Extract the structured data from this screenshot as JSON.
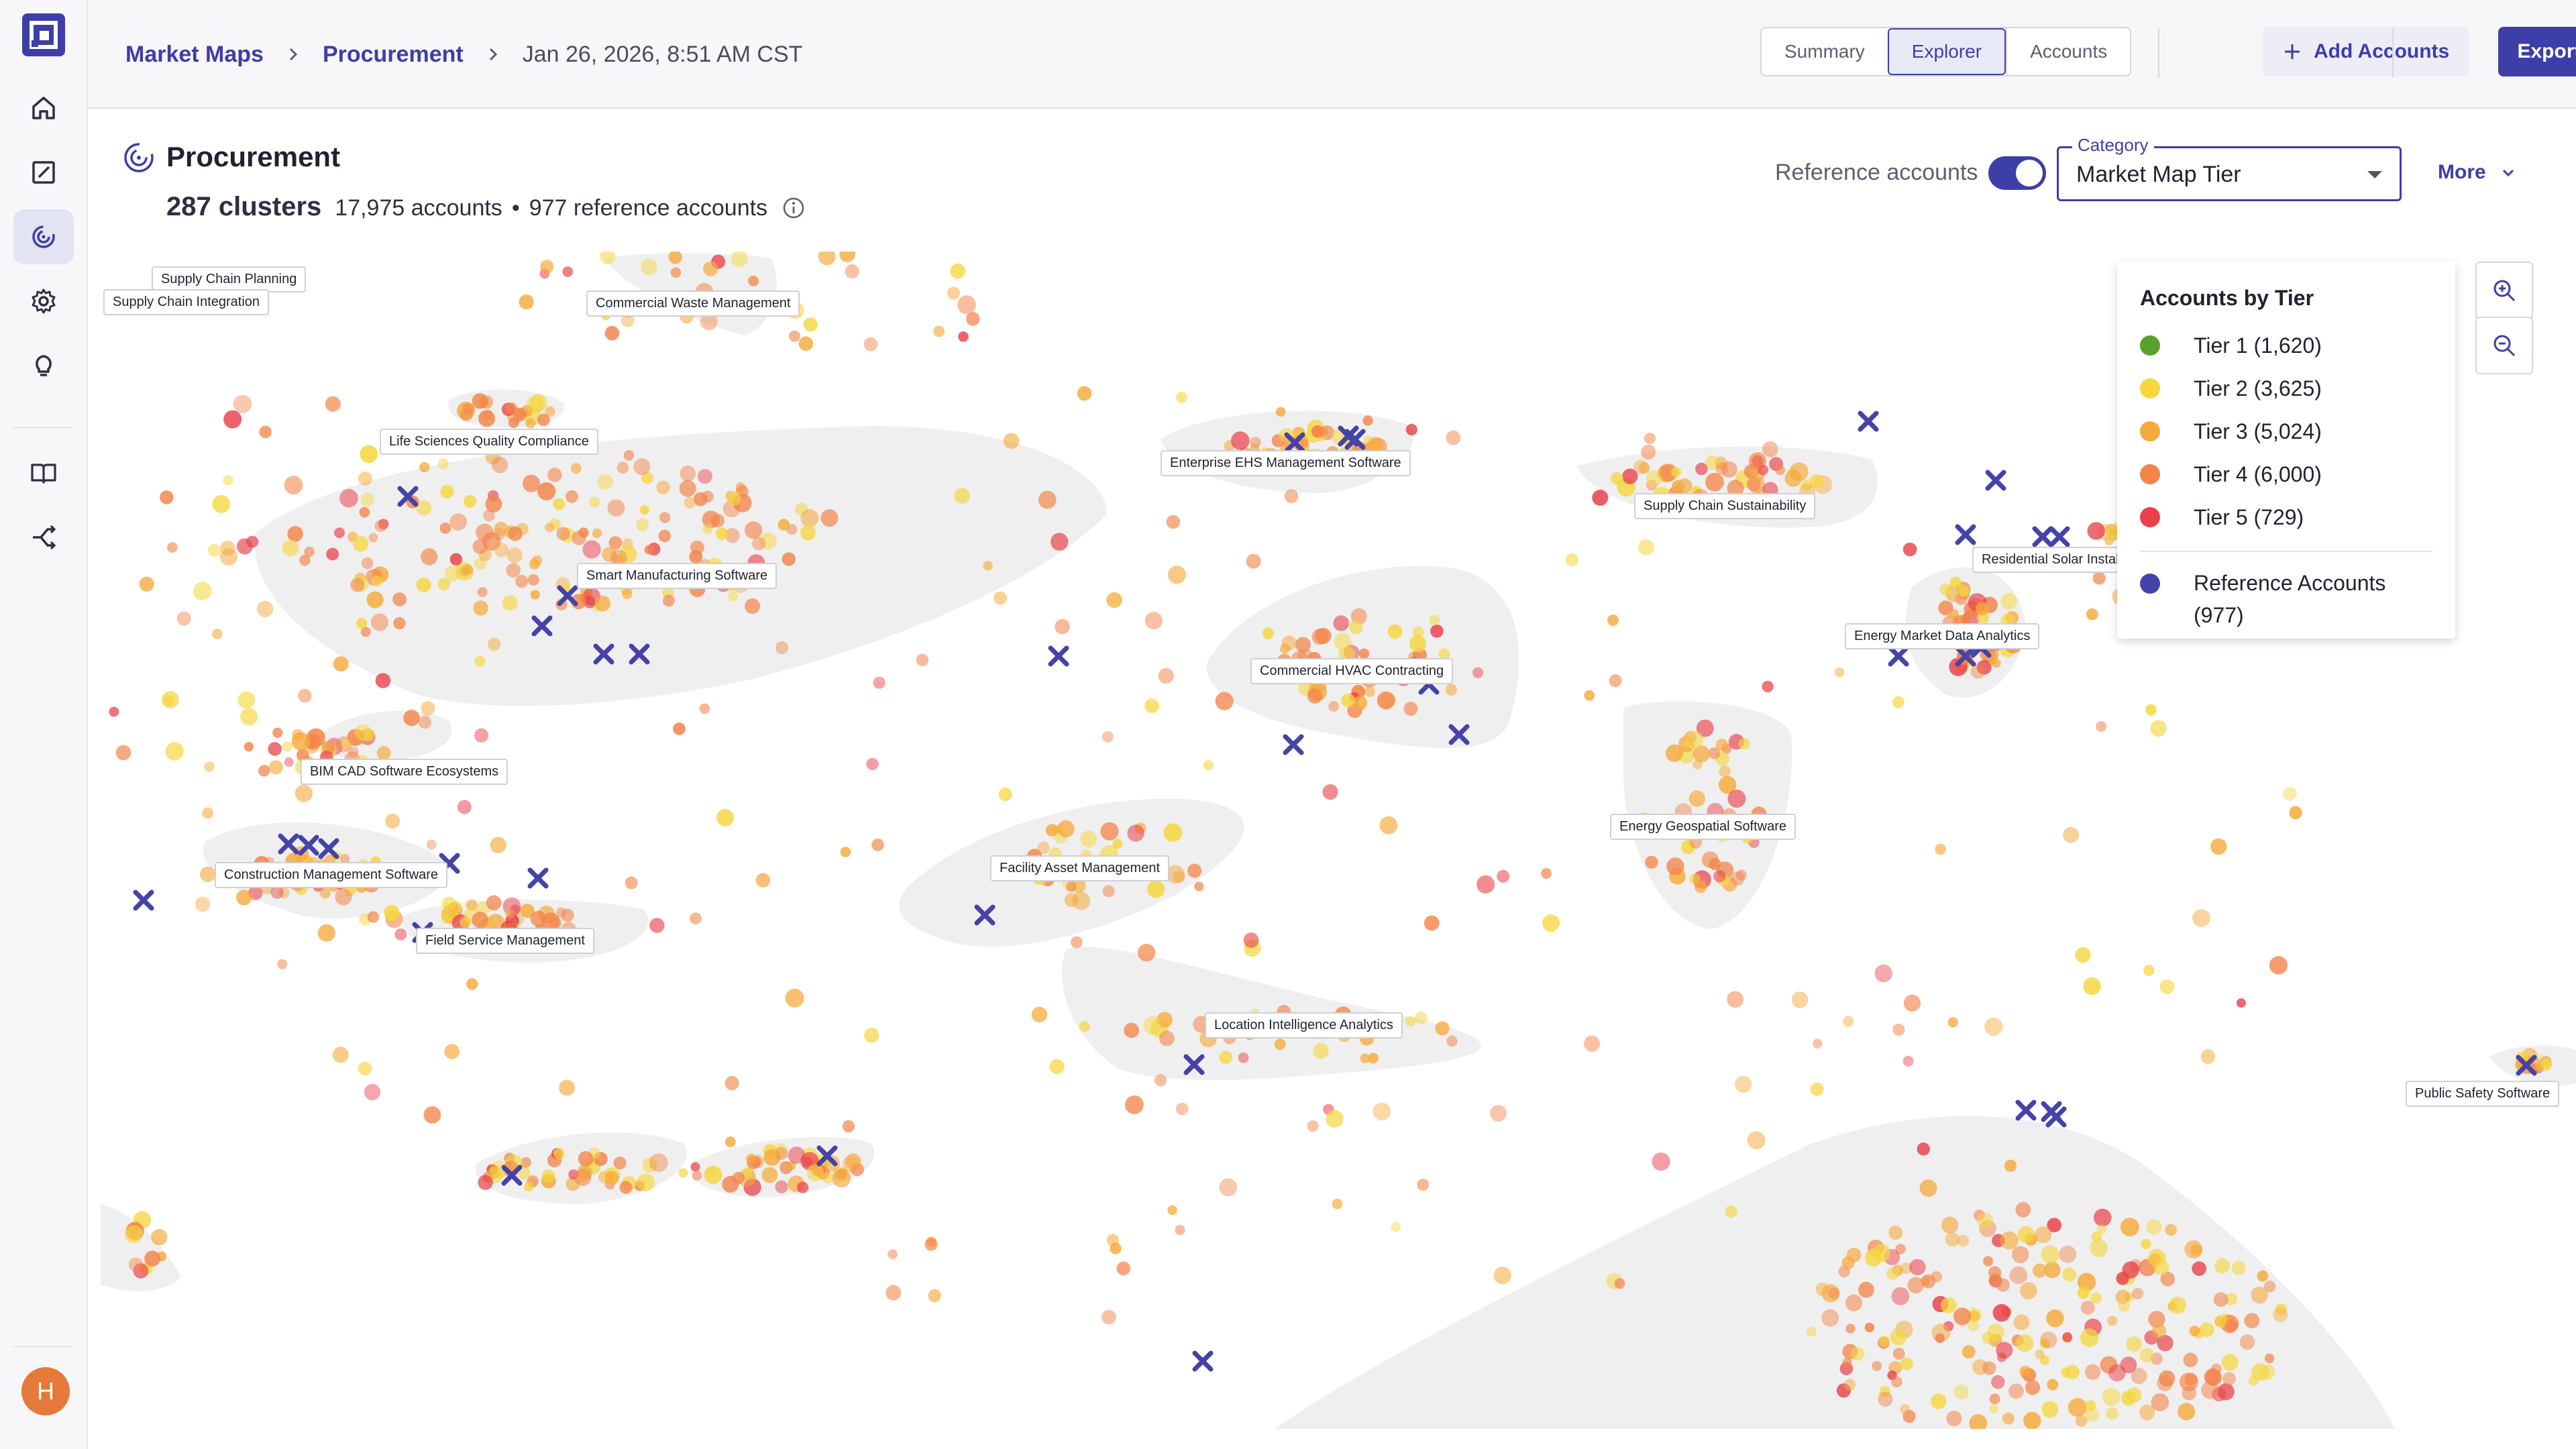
{
  "breadcrumb": {
    "items": [
      "Market Maps",
      "Procurement"
    ],
    "current": "Jan 26, 2026, 8:51 AM CST"
  },
  "view_tabs": [
    "Summary",
    "Explorer",
    "Accounts"
  ],
  "active_tab": "Explorer",
  "actions": {
    "add_accounts": "Add Accounts",
    "export": "Export"
  },
  "page": {
    "title": "Procurement",
    "clusters": "287 clusters",
    "accounts": "17,975 accounts",
    "separator": "•",
    "reference_accounts": "977 reference accounts"
  },
  "controls": {
    "reference_toggle_label": "Reference accounts",
    "reference_toggle_on": true,
    "category_label": "Category",
    "category_value": "Market Map Tier",
    "more_label": "More"
  },
  "user": {
    "initial": "H"
  },
  "legend": {
    "title": "Accounts by Tier",
    "items": [
      {
        "label": "Tier 1 (1,620)",
        "color": "#5aa02c"
      },
      {
        "label": "Tier 2 (3,625)",
        "color": "#f5d63d"
      },
      {
        "label": "Tier 3 (5,024)",
        "color": "#f6a93b"
      },
      {
        "label": "Tier 4 (6,000)",
        "color": "#f3844a"
      },
      {
        "label": "Tier 5 (729)",
        "color": "#e9404a"
      }
    ],
    "reference": {
      "label": "Reference Accounts (977)",
      "color": "#4543a8"
    }
  },
  "clusters": [
    "Supply Chain Planning",
    "Supply Chain Integration",
    "Commercial Waste Management",
    "Life Sciences Quality Compliance",
    "Smart Manufacturing Software",
    "Enterprise EHS Management Software",
    "Supply Chain Sustainability",
    "Residential Solar Install",
    "Energy Market Data Analytics",
    "Commercial HVAC Contracting",
    "BIM CAD Software Ecosystems",
    "Construction Management Software",
    "Field Service Management",
    "Facility Asset Management",
    "Energy Geospatial Software",
    "Location Intelligence Analytics",
    "Public Safety Software"
  ],
  "colors": {
    "brand": "#3d3ea8",
    "tier_1": "#5aa02c",
    "tier_2": "#f5d63d",
    "tier_3": "#f6a93b",
    "tier_4": "#f3844a",
    "tier_5": "#e9404a",
    "reference": "#4543a8"
  }
}
